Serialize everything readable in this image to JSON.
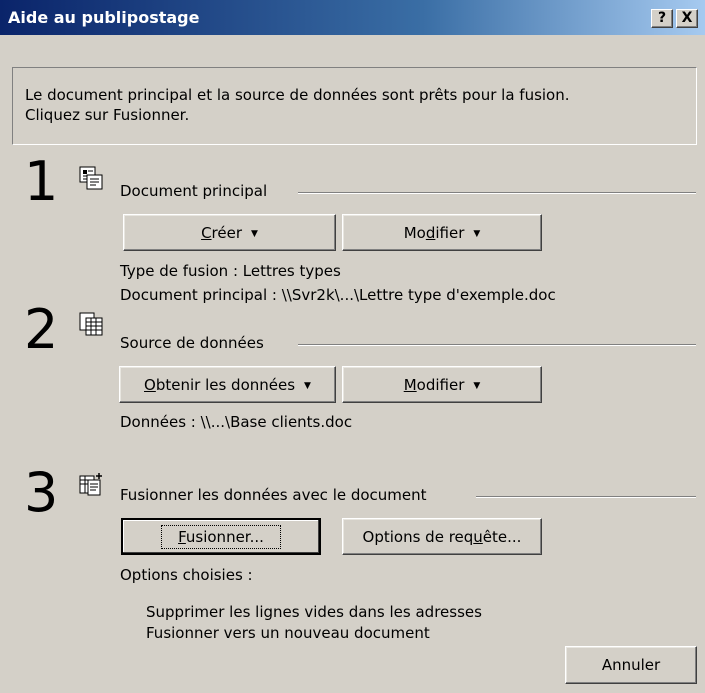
{
  "window": {
    "title": "Aide au publipostage",
    "help_button": "?",
    "close_button": "X"
  },
  "info": {
    "text": "Le document principal et la source de données sont prêts pour la fusion.\nCliquez sur Fusionner."
  },
  "step1": {
    "number": "1",
    "label": "Document principal",
    "create_button": {
      "before": "",
      "underlined": "C",
      "after": "réer"
    },
    "modify_button": {
      "before": "Mo",
      "underlined": "d",
      "after": "ifier"
    },
    "merge_type": "Type de fusion : Lettres types",
    "main_document": "Document principal : \\\\Svr2k\\...\\Lettre type d'exemple.doc"
  },
  "step2": {
    "number": "2",
    "label": "Source de données",
    "get_data_button": {
      "before": "",
      "underlined": "O",
      "after": "btenir les données"
    },
    "modify_button": {
      "before": "",
      "underlined": "M",
      "after": "odifier"
    },
    "data": "Données : \\\\...\\Base clients.doc"
  },
  "step3": {
    "number": "3",
    "label": "Fusionner les données avec le document",
    "merge_button": {
      "before": "",
      "underlined": "F",
      "after": "usionner..."
    },
    "query_options_button": {
      "before": "Options de req",
      "underlined": "u",
      "after": "ête..."
    },
    "options_label": "Options choisies :",
    "options": [
      "Supprimer les lignes vides dans les adresses",
      "Fusionner vers un nouveau document"
    ]
  },
  "cancel_button": "Annuler",
  "dropdown_arrow": "▼"
}
